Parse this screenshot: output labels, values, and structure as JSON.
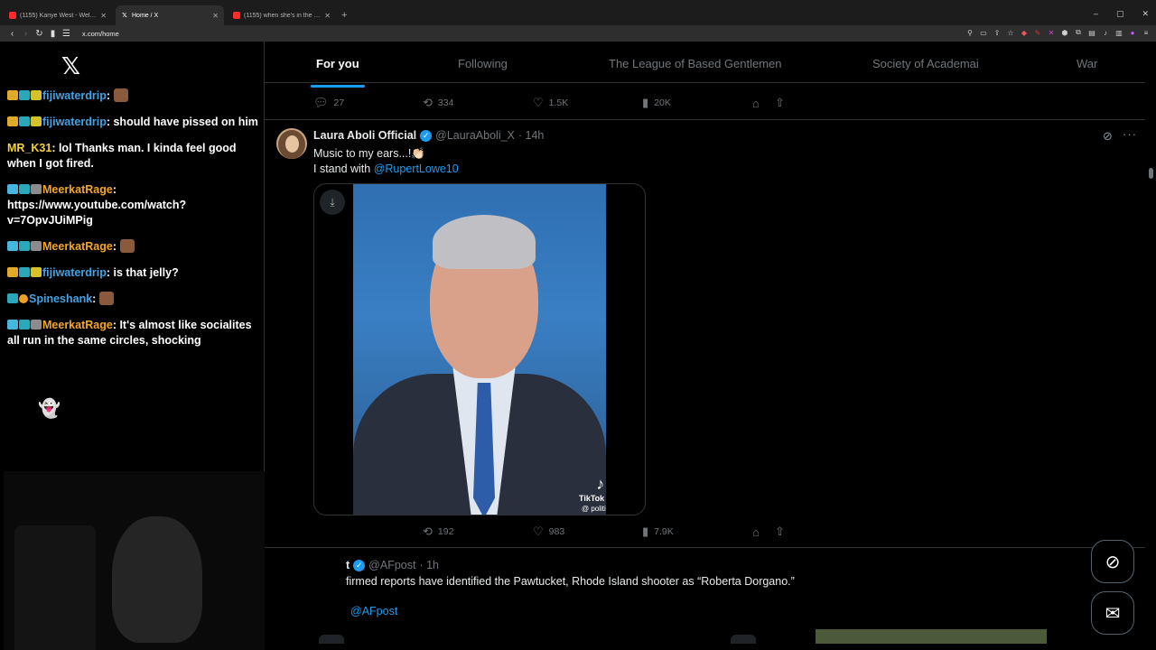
{
  "browser": {
    "tabs": [
      {
        "title": "(1155) Kanye West - Welcome To He",
        "icon": "youtube-icon",
        "active": false
      },
      {
        "title": "Home / X",
        "icon": "x-icon",
        "active": true
      },
      {
        "title": "(1155) when she's in the mood - You",
        "icon": "youtube-icon",
        "active": false
      }
    ],
    "new_tab": "+",
    "url": "x.com/home",
    "window_controls": [
      "–",
      "▢",
      "✕"
    ]
  },
  "chat": {
    "messages": [
      {
        "user": "fijiwaterdrip",
        "user_color": "#3fa3e6",
        "badges": [
          "gold",
          "teal",
          "yel"
        ],
        "text": ":",
        "emote": true
      },
      {
        "user": "fijiwaterdrip",
        "user_color": "#3fa3e6",
        "badges": [
          "gold",
          "teal",
          "yel"
        ],
        "text": ": should have pissed on him",
        "emote": false
      },
      {
        "user": "MR_K31",
        "user_color": "#f4d03f",
        "badges": [],
        "text": ": lol Thanks man. I kinda feel good when I got fired.",
        "emote": false
      },
      {
        "user": "MeerkatRage",
        "user_color": "#f5a623",
        "badges": [
          "cyan",
          "teal",
          "grey"
        ],
        "text": ": https://www.youtube.com/watch?v=7OpvJUiMPig",
        "emote": false
      },
      {
        "user": "MeerkatRage",
        "user_color": "#f5a623",
        "badges": [
          "cyan",
          "teal",
          "grey"
        ],
        "text": ":",
        "emote": true
      },
      {
        "user": "fijiwaterdrip",
        "user_color": "#3fa3e6",
        "badges": [
          "gold",
          "teal",
          "yel"
        ],
        "text": ": is that jelly?",
        "emote": false
      },
      {
        "user": "Spineshank",
        "user_color": "#3fa3e6",
        "badges": [
          "teal",
          "orn"
        ],
        "text": ":",
        "emote": true
      },
      {
        "user": "MeerkatRage",
        "user_color": "#f5a623",
        "badges": [
          "cyan",
          "teal",
          "grey"
        ],
        "text": ": It's almost like socialites all run in the same circles, shocking",
        "emote": false
      }
    ]
  },
  "timeline": {
    "tabs": [
      "For you",
      "Following",
      "The League of Based Gentlemen",
      "Society of Academai",
      "War"
    ],
    "active_tab": "For you",
    "prev_tweet_actions": {
      "replies": "27",
      "reposts": "334",
      "likes": "1.5K",
      "views": "20K"
    },
    "tweet": {
      "name": "Laura Aboli Official",
      "handle": "@LauraAboli_X",
      "time": "· 14h",
      "text_line1": "Music to my ears...!👏🏻",
      "text_line2_prefix": "I stand with ",
      "mention": "@RupertLowe10",
      "video_watermark": "TikTok",
      "video_handle": "@ politicsfoc",
      "actions": {
        "reposts": "192",
        "likes": "983",
        "views": "7.9K"
      }
    },
    "next_tweet": {
      "name_fragment": "t",
      "handle": "@AFpost",
      "time": "· 1h",
      "text": "firmed reports have identified the Pawtucket, Rhode Island shooter as “Roberta Dorgano.”",
      "link": "@AFpost"
    }
  },
  "colors": {
    "accent": "#1d9bf0",
    "bg": "#000000",
    "border": "#2f3336",
    "muted": "#71767b"
  }
}
